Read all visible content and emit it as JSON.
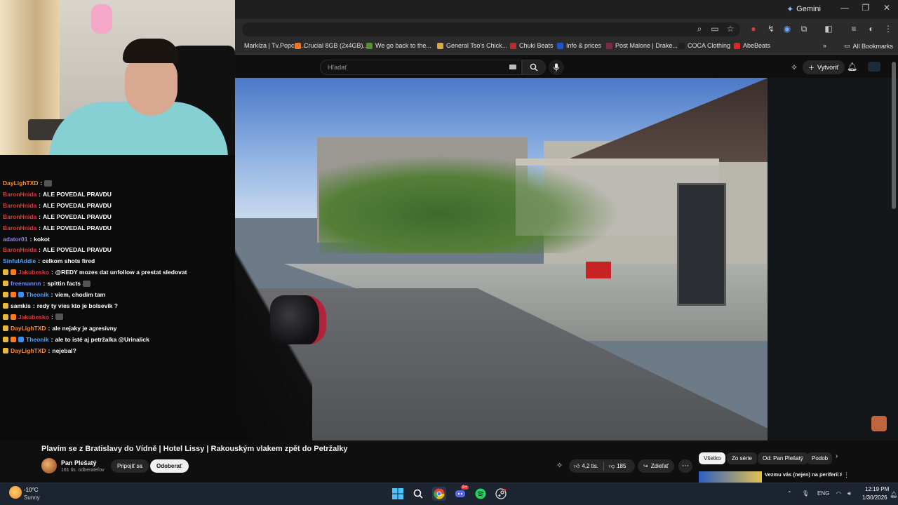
{
  "browser": {
    "gemini_label": "Gemini",
    "window_controls": [
      "—",
      "❐",
      "✕"
    ],
    "bookmarks": [
      {
        "label": "Markíza | Tv.Popcor...",
        "color": "#2a2a2a"
      },
      {
        "label": "Crucial 8GB (2x4GB)...",
        "color": "#e8782c"
      },
      {
        "label": "We go back to the...",
        "color": "#5a8f3a"
      },
      {
        "label": "General Tso's Chick...",
        "color": "#d8a94b"
      },
      {
        "label": "Chuki Beats",
        "color": "#c4262e"
      },
      {
        "label": "Info & prices",
        "color": "#1d57c9"
      },
      {
        "label": "Post Malone | Drake...",
        "color": "#7a2b48"
      },
      {
        "label": "COCA Clothing",
        "color": "#1f1f1f"
      },
      {
        "label": "AbeBeats",
        "color": "#d22b2b"
      }
    ],
    "bookmarks_overflow": "»",
    "all_bookmarks_label": "All Bookmarks"
  },
  "youtube": {
    "search_placeholder": "Hľadať",
    "create_label": "Vytvoriť",
    "video_title": "Plavím se z Bratislavy do Vídně | Hotel Lissy | Rakouským vlakem zpět do Petržalky",
    "channel_name": "Pan Plešatý",
    "channel_subs": "161 tis. odberateľov",
    "join_label": "Pripojiť sa",
    "subscribe_label": "Odoberať",
    "likes": "4,2 tis.",
    "dislikes": "185",
    "share_label": "Zdieľať",
    "more_label": "⋯",
    "chips": [
      "Všetko",
      "Zo série",
      "Od: Pan Plešatý",
      "Podob"
    ],
    "chip_next": "›",
    "reco_title": "Vezmu vás (nejen) na periferii Paříže | ...Jedu vlakem TGV"
  },
  "chat": [
    {
      "user": "DayLighTXD",
      "color": "#ff8c2b",
      "msg": "",
      "emote": true
    },
    {
      "user": "BaronHnida",
      "color": "#e0373b",
      "msg": "ALE POVEDAL PRAVDU"
    },
    {
      "user": "BaronHnida",
      "color": "#e0373b",
      "msg": "ALE POVEDAL PRAVDU"
    },
    {
      "user": "BaronHnida",
      "color": "#e0373b",
      "msg": "ALE POVEDAL PRAVDU"
    },
    {
      "user": "BaronHnida",
      "color": "#e0373b",
      "msg": "ALE POVEDAL PRAVDU"
    },
    {
      "user": "adator01",
      "color": "#9a7bff",
      "msg": "kokot"
    },
    {
      "user": "BaronHnida",
      "color": "#e0373b",
      "msg": "ALE POVEDAL PRAVDU"
    },
    {
      "user": "SinfulAddie",
      "color": "#4aa3ff",
      "msg": "celkom shots fired"
    },
    {
      "user": "Jakubesko",
      "color": "#e0373b",
      "msg": "@REDY mozes dat unfollow a prestat sledovat",
      "badges": 2
    },
    {
      "user": "freemannn",
      "color": "#6e8bff",
      "msg": "spittin facts",
      "badges": 1,
      "emote": true
    },
    {
      "user": "Theonik",
      "color": "#4aa3ff",
      "msg": "viem, chodim tam",
      "badges": 3
    },
    {
      "user": "samkis",
      "color": "#ffffff",
      "msg": "redy ty vies kto je bolsevik ?",
      "badges": 1
    },
    {
      "user": "Jakubesko",
      "color": "#e0373b",
      "msg": "",
      "badges": 2,
      "emote": true
    },
    {
      "user": "DayLighTXD",
      "color": "#ff8c2b",
      "msg": "ale nejaky je agresivny",
      "badges": 1
    },
    {
      "user": "Theonik",
      "color": "#4aa3ff",
      "msg": "ale to isté aj petržalka @Urinalick",
      "badges": 3
    },
    {
      "user": "DayLighTXD",
      "color": "#ff8c2b",
      "msg": "nejebal?",
      "badges": 1
    }
  ],
  "taskbar": {
    "temperature": "-10°C",
    "condition": "Sunny",
    "lang": "ENG",
    "time": "12:19 PM",
    "date": "1/30/2026",
    "apps": [
      "windows-start",
      "search",
      "chrome",
      "discord",
      "spotify",
      "steam"
    ],
    "discord_badge": "9+"
  },
  "colors": {
    "accent": "#f1f1f1",
    "subscribe_bg": "#f1f1f1",
    "chip_active_bg": "#f1f1f1"
  }
}
